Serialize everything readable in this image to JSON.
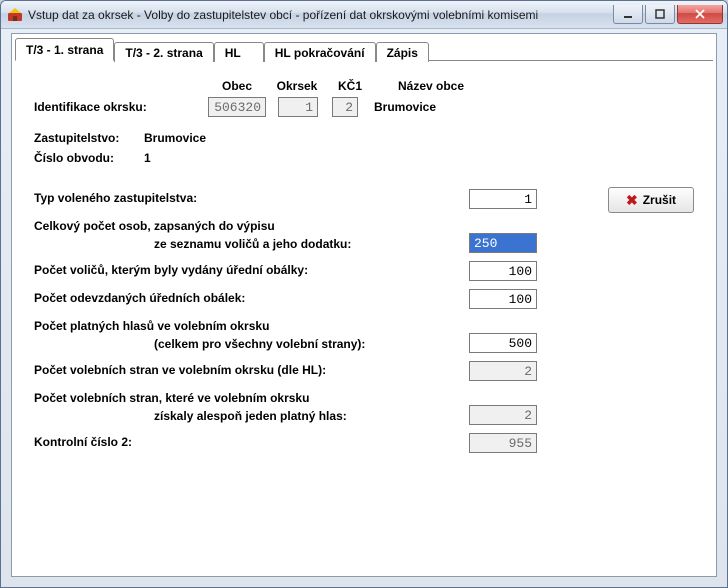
{
  "window": {
    "title": "Vstup dat za okrsek - Volby do zastupitelstev obcí - pořízení dat okrskovými volebními komisemi"
  },
  "tabs": {
    "t1": "T/3 - 1. strana",
    "t2": "T/3 - 2. strana",
    "t3": "HL",
    "t4": "HL pokračování",
    "t5": "Zápis"
  },
  "headers": {
    "obec": "Obec",
    "okrsek": "Okrsek",
    "kc1": "KČ1",
    "nazev_obce": "Název obce"
  },
  "ident": {
    "label": "Identifikace okrsku:",
    "obec": "506320",
    "okrsek": "1",
    "kc1": "2",
    "nazev": "Brumovice"
  },
  "zast": {
    "label": "Zastupitelstvo:",
    "value": "Brumovice"
  },
  "obvod": {
    "label": "Číslo obvodu:",
    "value": "1"
  },
  "fields": {
    "typ": {
      "label": "Typ voleného zastupitelstva:",
      "value": "1"
    },
    "osoby": {
      "label1": "Celkový počet osob, zapsaných do výpisu",
      "label2": "ze seznamu voličů a jeho dodatku:",
      "value": "250"
    },
    "obalky_vydane": {
      "label": "Počet voličů, kterým byly vydány úřední obálky:",
      "value": "100"
    },
    "obalky_odevzdane": {
      "label": "Počet odevzdaných úředních obálek:",
      "value": "100"
    },
    "hlasy": {
      "label1": "Počet platných hlasů ve volebním okrsku",
      "label2": "(celkem pro všechny volební strany):",
      "value": "500"
    },
    "strany_hl": {
      "label": "Počet volebních stran ve volebním okrsku (dle HL):",
      "value": "2"
    },
    "strany_hlas": {
      "label1": "Počet volebních stran, které ve volebním okrsku",
      "label2": "získaly alespoň jeden platný hlas:",
      "value": "2"
    },
    "kc2": {
      "label": "Kontrolní číslo 2:",
      "value": "955"
    }
  },
  "buttons": {
    "cancel": "Zrušit"
  }
}
